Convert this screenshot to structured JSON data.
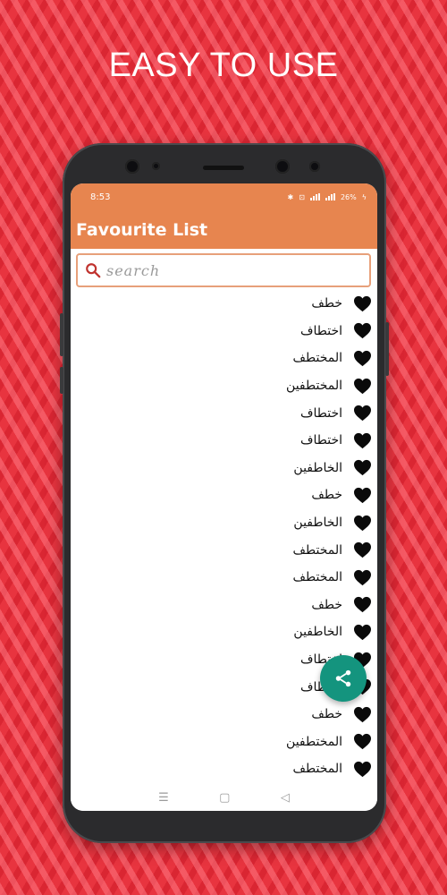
{
  "headline": "EASY TO USE",
  "status_bar": {
    "time": "8:53",
    "battery": "26%"
  },
  "app_bar": {
    "title": "Favourite List",
    "color": "#e7854f"
  },
  "search": {
    "placeholder": "search",
    "icon": "search-icon"
  },
  "favourites": [
    {
      "word": "خطف"
    },
    {
      "word": "اختطاف"
    },
    {
      "word": "المختطف"
    },
    {
      "word": "المختطفين"
    },
    {
      "word": "اختطاف"
    },
    {
      "word": "اختطاف"
    },
    {
      "word": "الخاطفين"
    },
    {
      "word": "خطف"
    },
    {
      "word": "الخاطفين"
    },
    {
      "word": "المختطف"
    },
    {
      "word": "المختطف"
    },
    {
      "word": "خطف"
    },
    {
      "word": "الخاطفين"
    },
    {
      "word": "اختطاف"
    },
    {
      "word": "اختطاف"
    },
    {
      "word": "خطف"
    },
    {
      "word": "المختطفين"
    },
    {
      "word": "المختطف"
    }
  ],
  "fab": {
    "icon": "share-icon",
    "color": "#14947e"
  },
  "nav_bar": {
    "icons": [
      "menu-icon",
      "home-icon",
      "back-icon"
    ]
  },
  "background_color": "#e8343f"
}
